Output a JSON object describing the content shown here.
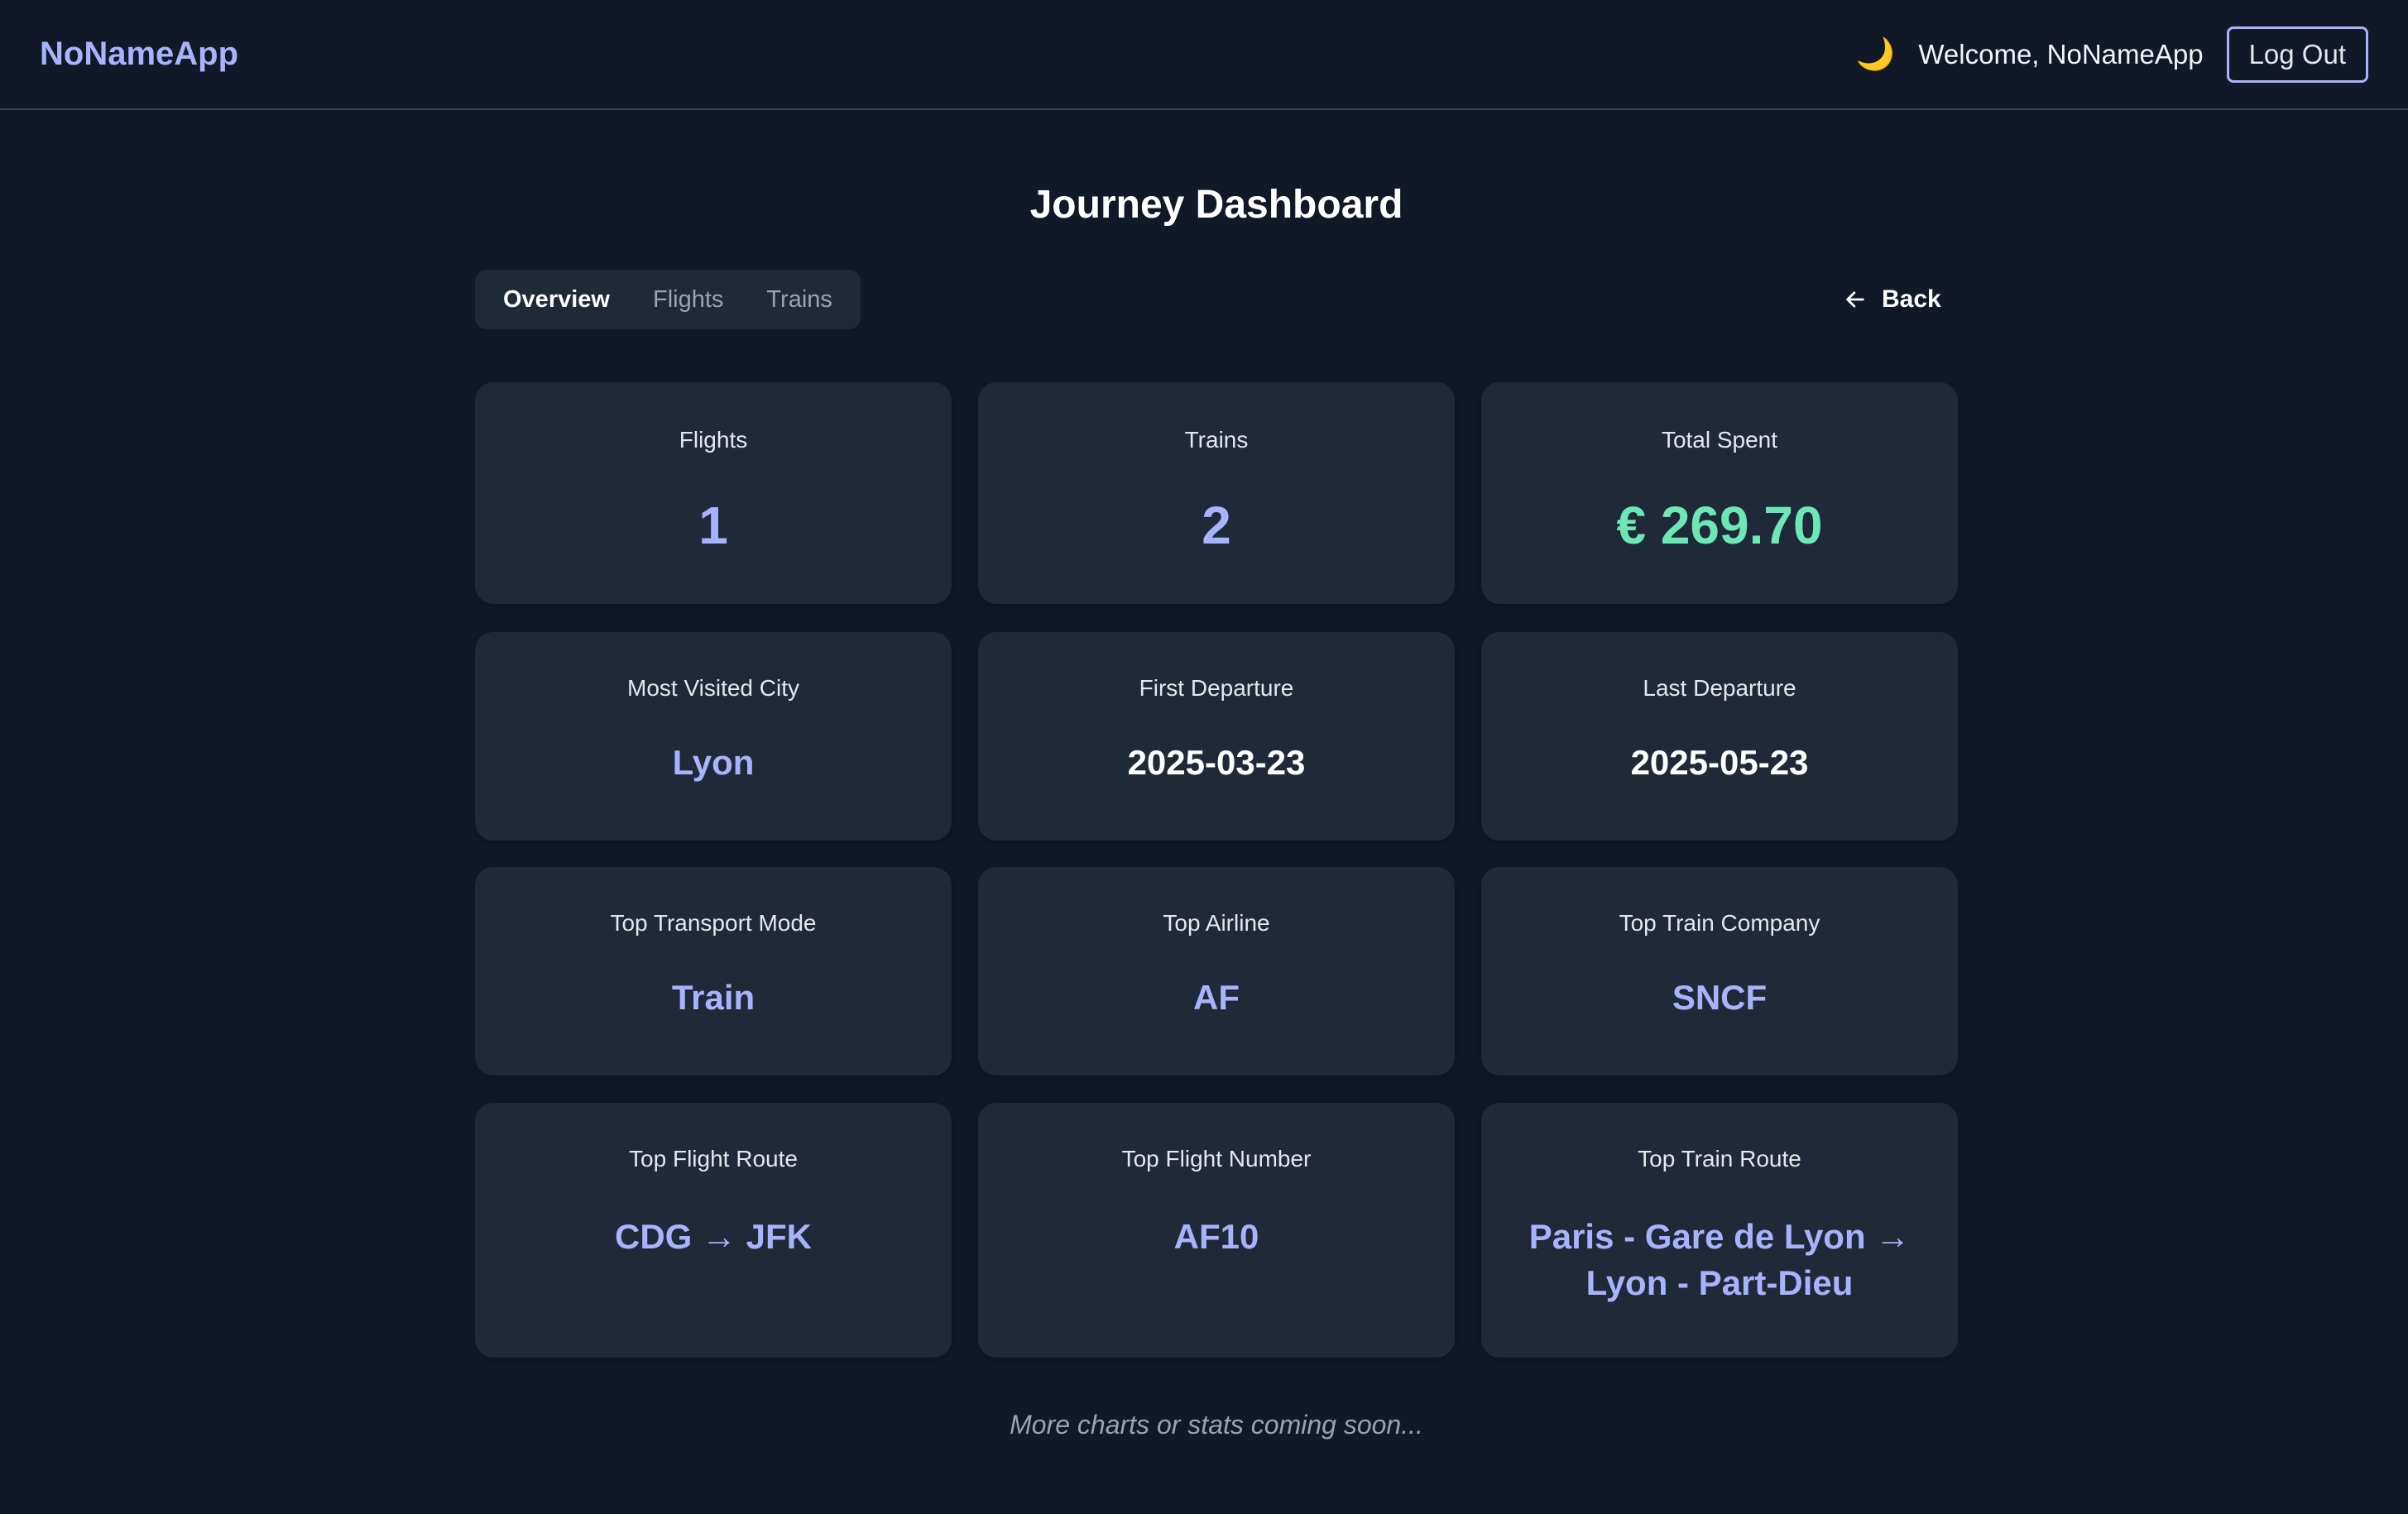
{
  "app": {
    "brand": "NoNameApp",
    "theme_icon": "moon-icon",
    "welcome": "Welcome, NoNameApp",
    "logout_label": "Log Out"
  },
  "page": {
    "title": "Journey Dashboard",
    "tabs": [
      {
        "label": "Overview",
        "active": true
      },
      {
        "label": "Flights",
        "active": false
      },
      {
        "label": "Trains",
        "active": false
      }
    ],
    "back_label": "Back"
  },
  "stats": {
    "flights": {
      "label": "Flights",
      "value": "1"
    },
    "trains": {
      "label": "Trains",
      "value": "2"
    },
    "total_spent": {
      "label": "Total Spent",
      "value": "€ 269.70"
    },
    "most_visited_city": {
      "label": "Most Visited City",
      "value": "Lyon"
    },
    "first_departure": {
      "label": "First Departure",
      "value": "2025-03-23"
    },
    "last_departure": {
      "label": "Last Departure",
      "value": "2025-05-23"
    },
    "top_transport_mode": {
      "label": "Top Transport Mode",
      "value": "Train"
    },
    "top_airline": {
      "label": "Top Airline",
      "value": "AF"
    },
    "top_train_company": {
      "label": "Top Train Company",
      "value": "SNCF"
    },
    "top_flight_route": {
      "label": "Top Flight Route",
      "value": "CDG → JFK"
    },
    "top_flight_number": {
      "label": "Top Flight Number",
      "value": "AF10"
    },
    "top_train_route": {
      "label": "Top Train Route",
      "value": "Paris - Gare de Lyon → Lyon - Part-Dieu"
    }
  },
  "footer_note": "More charts or stats coming soon...",
  "colors": {
    "background": "#111827",
    "card": "#1f2937",
    "accent": "#a5b4fc",
    "money": "#6ee7b7"
  }
}
